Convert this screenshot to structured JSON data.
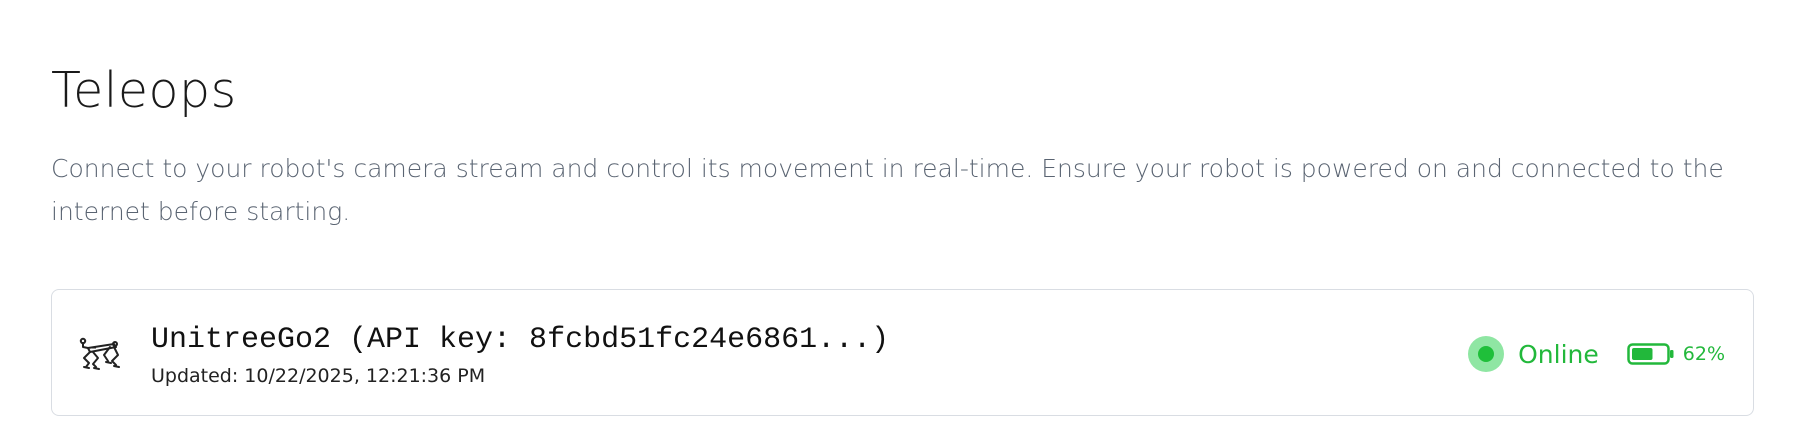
{
  "page": {
    "title": "Teleops",
    "description": "Connect to your robot's camera stream and control its movement in real-time. Ensure your robot is powered on and connected to the internet before starting."
  },
  "robot": {
    "name": "UnitreeGo2 (API key: 8fcbd51fc24e6861...)",
    "updated": "Updated: 10/22/2025, 12:21:36 PM",
    "icon": "robot-dog-icon",
    "status": {
      "label": "Online",
      "color": "#22b83b",
      "dot_outer_color": "#8fe6a3",
      "dot_inner_color": "#1fbf3a"
    },
    "battery": {
      "label": "62%",
      "level": 0.62,
      "icon": "battery-icon",
      "color": "#22b83b"
    }
  },
  "colors": {
    "text_primary": "#1a1a1a",
    "text_secondary": "#5a6472",
    "card_border": "#d9dde3",
    "success": "#22b83b"
  }
}
